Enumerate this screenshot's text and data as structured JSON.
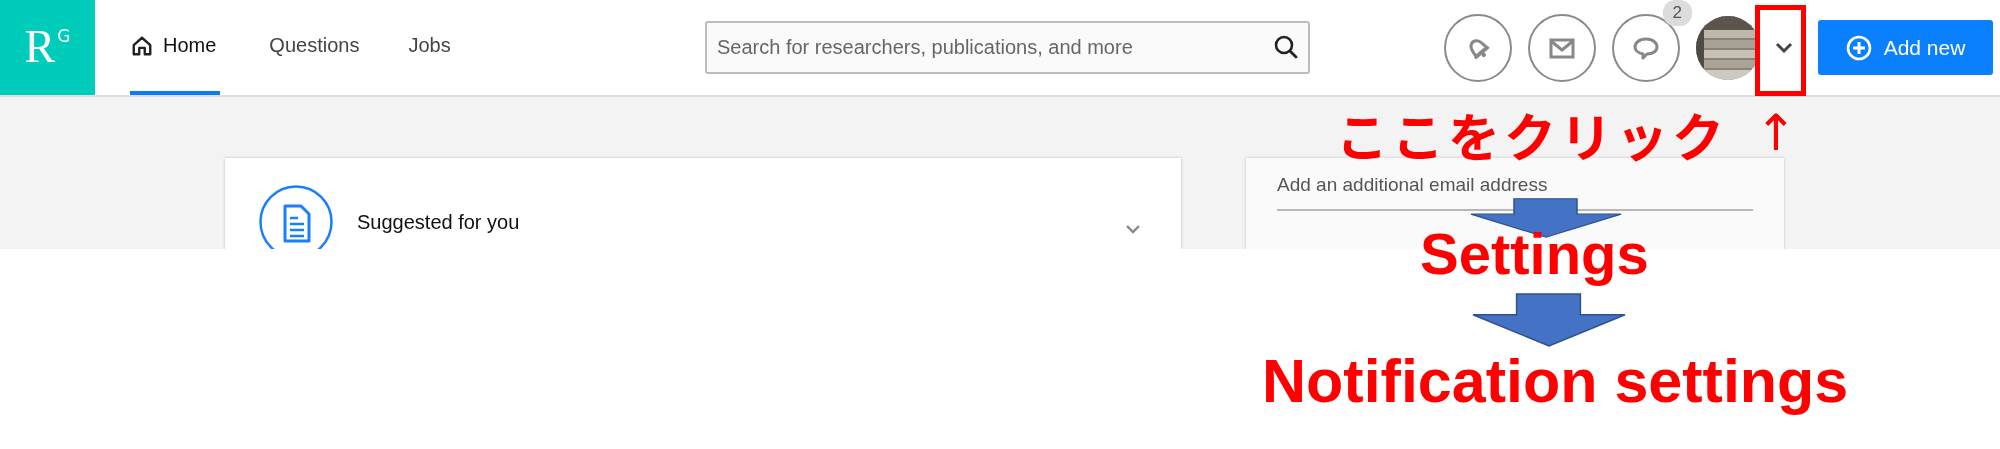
{
  "logo": {
    "letter": "R",
    "superscript": "G"
  },
  "nav": [
    {
      "label": "Home",
      "kind": "home",
      "selected": true
    },
    {
      "label": "Questions",
      "kind": "plain",
      "selected": false
    },
    {
      "label": "Jobs",
      "kind": "plain",
      "selected": false
    }
  ],
  "search": {
    "placeholder": "Search for researchers, publications, and more"
  },
  "header_icons": [
    {
      "kind": "bell"
    },
    {
      "kind": "mail"
    },
    {
      "kind": "chat",
      "badge": "2"
    }
  ],
  "add_button": {
    "label": "Add new"
  },
  "feed_card": {
    "title": "Suggested for you"
  },
  "email_field": {
    "placeholder": "Add an additional email address"
  },
  "annotations": {
    "click_hint": "ここをクリック",
    "hint_arrow": "↑",
    "steps": [
      "Settings",
      "Notification settings"
    ]
  }
}
